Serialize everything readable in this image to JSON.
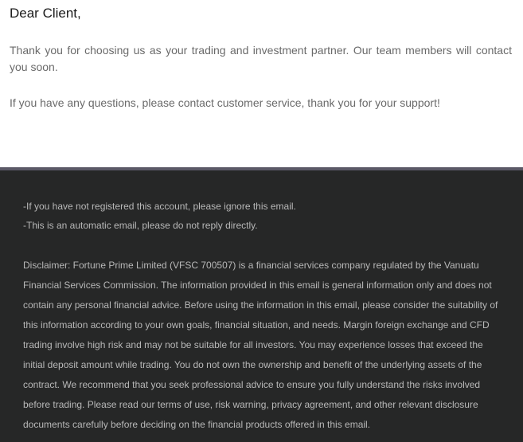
{
  "greeting": "Dear Client,",
  "body": {
    "paragraph1": "Thank you for choosing us as your trading and investment partner. Our team members will contact you soon.",
    "paragraph2": "If you have any questions, please contact customer service, thank you for your support!"
  },
  "footer": {
    "note1": "-If you have not registered this account, please ignore this email.",
    "note2": "-This is an automatic email, please do not reply directly.",
    "disclaimer": "Disclaimer: Fortune Prime Limited (VFSC 700507) is a financial services company regulated by the Vanuatu Financial Services Commission. The information provided in this email is general information only and does not contain any personal financial advice. Before using the information in this email, please consider the suitability of this information according to your own goals, financial situation, and needs. Margin foreign exchange and CFD trading involve high risk and may not be suitable for all investors. You may experience losses that exceed the initial deposit amount while trading. You do not own the ownership and benefit of the underlying assets of the contract. We recommend that you seek professional advice to ensure you fully understand the risks involved before trading. Please read our terms of use, risk warning, privacy agreement, and other relevant disclosure documents carefully before deciding on the financial products offered in this email."
  },
  "colors": {
    "footer_background": "#262727",
    "divider": "#5a5866",
    "body_text": "#6a6a6a",
    "footer_text": "#b8b8b8"
  }
}
